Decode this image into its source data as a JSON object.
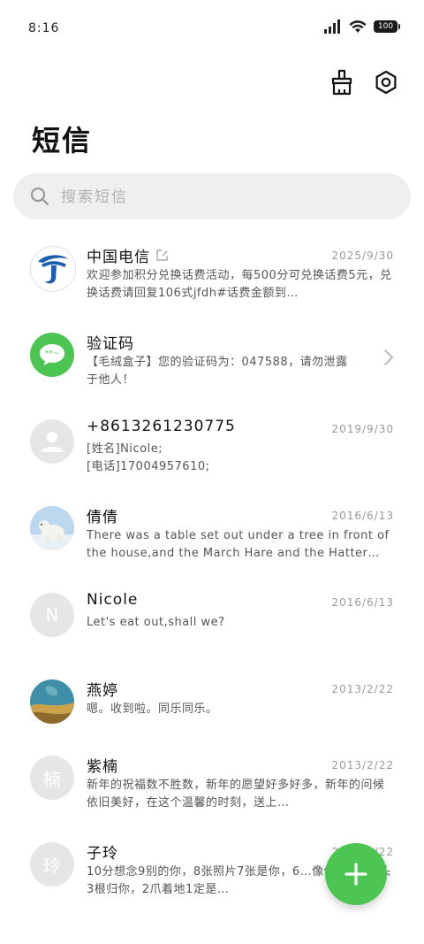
{
  "status_bar": {
    "time": "8:16",
    "battery": "100"
  },
  "header": {
    "title": "短信",
    "clean_icon": "broom-icon",
    "settings_icon": "gear-icon"
  },
  "search": {
    "placeholder": "搜索短信"
  },
  "conversations": [
    {
      "name": "中国电信",
      "time": "2025/9/30",
      "preview": "欢迎参加积分兑换话费活动，每500分可兑换话费5元，兑换话费请回复106式jfdh#话费金额到…",
      "avatar": "china-telecom-logo",
      "has_edit_icon": true
    },
    {
      "name": "验证码",
      "time": "",
      "preview": "【毛绒盒子】您的验证码为：047588，请勿泄露于他人！",
      "avatar": "message-bubble"
    },
    {
      "name": "+8613261230775",
      "time": "2019/9/30",
      "preview": "[姓名]Nicole;\n[电话]17004957610;",
      "avatar": "person-placeholder"
    },
    {
      "name": "倩倩",
      "time": "2016/6/13",
      "preview": "There was a table set out under a tree in front of the house,and the March Hare and the Hatter were…",
      "avatar": "polar-bear-photo"
    },
    {
      "name": "Nicole",
      "time": "2016/6/13",
      "preview": "Let's eat out,shall we?",
      "avatar": "N"
    },
    {
      "name": "燕婷",
      "time": "2013/2/22",
      "preview": "嗯。收到啦。同乐同乐。",
      "avatar": "landscape-photo"
    },
    {
      "name": "紫楠",
      "time": "2013/2/22",
      "preview": "新年的祝福数不胜数，新年的愿望好多好多，新年的问候依旧美好，在这个温馨的时刻，送上…",
      "avatar": "楠"
    },
    {
      "name": "子玲",
      "time": "2013/2/22",
      "preview": "10分想念9别的你，8张照片7张是你，6…像你，4根骨头3根归你，2爪着地1定是…",
      "avatar": "玲"
    }
  ],
  "fab": {
    "icon": "plus-icon",
    "color": "#4cc552"
  }
}
